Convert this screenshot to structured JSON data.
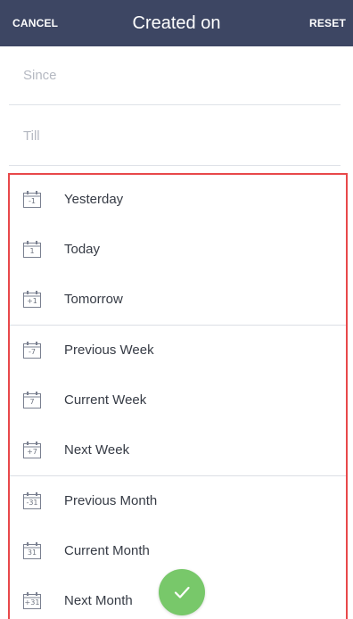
{
  "header": {
    "cancel_label": "CANCEL",
    "title": "Created on",
    "reset_label": "RESET"
  },
  "fields": {
    "since_placeholder": "Since",
    "since_value": "",
    "till_placeholder": "Till",
    "till_value": ""
  },
  "groups": [
    {
      "items": [
        {
          "label": "Yesterday",
          "icon": "calendar-icon",
          "icon_text": "-1"
        },
        {
          "label": "Today",
          "icon": "calendar-icon",
          "icon_text": "1"
        },
        {
          "label": "Tomorrow",
          "icon": "calendar-icon",
          "icon_text": "+1"
        }
      ]
    },
    {
      "items": [
        {
          "label": "Previous Week",
          "icon": "calendar-icon",
          "icon_text": "-7"
        },
        {
          "label": "Current Week",
          "icon": "calendar-icon",
          "icon_text": "7"
        },
        {
          "label": "Next Week",
          "icon": "calendar-icon",
          "icon_text": "+7"
        }
      ]
    },
    {
      "items": [
        {
          "label": "Previous Month",
          "icon": "calendar-icon",
          "icon_text": "-31"
        },
        {
          "label": "Current Month",
          "icon": "calendar-icon",
          "icon_text": "31"
        },
        {
          "label": "Next Month",
          "icon": "calendar-icon",
          "icon_text": "+31"
        }
      ]
    }
  ],
  "apply_button": {
    "icon": "checkmark-icon"
  },
  "colors": {
    "header_bg": "#3d4663",
    "highlight_border": "#e8484a",
    "apply_green": "#78c86a"
  }
}
